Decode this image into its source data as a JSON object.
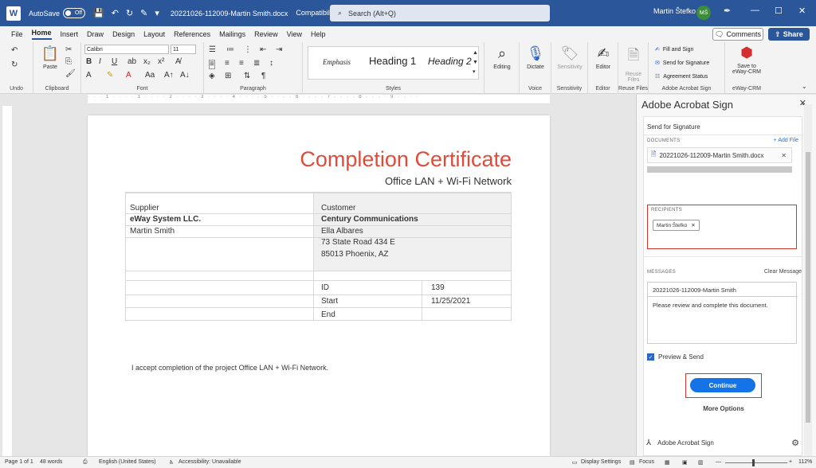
{
  "titlebar": {
    "app_letter": "W",
    "autosave_label": "AutoSave",
    "autosave_state": "Off",
    "doc_title": "20221026-112009-Martin Smith.docx",
    "mode": "Compatibility Mode",
    "search_placeholder": "Search (Alt+Q)",
    "user_name": "Martin Štefko",
    "user_initials": "MŠ"
  },
  "menu": {
    "tabs": [
      "File",
      "Home",
      "Insert",
      "Draw",
      "Design",
      "Layout",
      "References",
      "Mailings",
      "Review",
      "View",
      "Help"
    ],
    "active": "Home",
    "comments_label": "Comments",
    "share_label": "Share"
  },
  "ribbon": {
    "groups": {
      "undo": "Undo",
      "clipboard": "Clipboard",
      "font": "Font",
      "paragraph": "Paragraph",
      "styles": "Styles",
      "voice": "Voice",
      "sensitivity": "Sensitivity",
      "editor": "Editor",
      "reuse_files": "Reuse Files",
      "adobe_acrobat_sign": "Adobe Acrobat Sign",
      "eway_crm": "eWay-CRM"
    },
    "paste_label": "Paste",
    "font_name": "Calibri",
    "font_size": "11",
    "styles": [
      "Emphasis",
      "Heading 1",
      "Heading 2"
    ],
    "editing_label": "Editing",
    "dictate_label": "Dictate",
    "sensitivity_label": "Sensitivity",
    "editor_label": "Editor",
    "reuse_label_1": "Reuse",
    "reuse_label_2": "Files",
    "acrobat_items": [
      "Fill and Sign",
      "Send for Signature",
      "Agreement Status"
    ],
    "save_to_label_1": "Save to",
    "save_to_label_2": "eWay-CRM"
  },
  "document": {
    "title": "Completion Certificate",
    "subtitle": "Office LAN + Wi-Fi Network",
    "supplier_header": "Supplier",
    "supplier_name": "eWay System LLC.",
    "supplier_contact": "Martin Smith",
    "customer_header": "Customer",
    "customer_name": "Century Communications",
    "customer_contact": "Ella Albares",
    "customer_address_1": "73 State Road 434 E",
    "customer_address_2": "85013 Phoenix, AZ",
    "fields": [
      {
        "label": "ID",
        "value": "139"
      },
      {
        "label": "Start",
        "value": "11/25/2021"
      },
      {
        "label": "End",
        "value": ""
      }
    ],
    "acceptance": "I accept completion of the project Office LAN + Wi-Fi Network."
  },
  "pane": {
    "title": "Adobe Acrobat Sign",
    "section_title": "Send for Signature",
    "documents_label": "DOCUMENTS",
    "add_file_label": "+ Add File",
    "document_file": "20221026-112009-Martin Smith.docx",
    "recipients_label": "RECIPIENTS",
    "recipient_chip": "Martin Štefko",
    "messages_label": "MESSAGES",
    "clear_message_label": "Clear Message",
    "message_subject": "20221026-112009-Martin Smith",
    "message_body": "Please review and complete this document.",
    "preview_send_label": "Preview & Send",
    "continue_label": "Continue",
    "more_options_label": "More Options",
    "footer_label": "Adobe Acrobat Sign"
  },
  "status": {
    "page": "Page 1 of 1",
    "words": "48 words",
    "language": "English (United States)",
    "accessibility": "Accessibility: Unavailable",
    "display_settings": "Display Settings",
    "focus": "Focus",
    "zoom": "112%"
  },
  "colors": {
    "word_blue": "#2b579a",
    "title_red": "#e04b3a",
    "highlight_red": "#d9342b",
    "continue_blue": "#1473e6"
  }
}
